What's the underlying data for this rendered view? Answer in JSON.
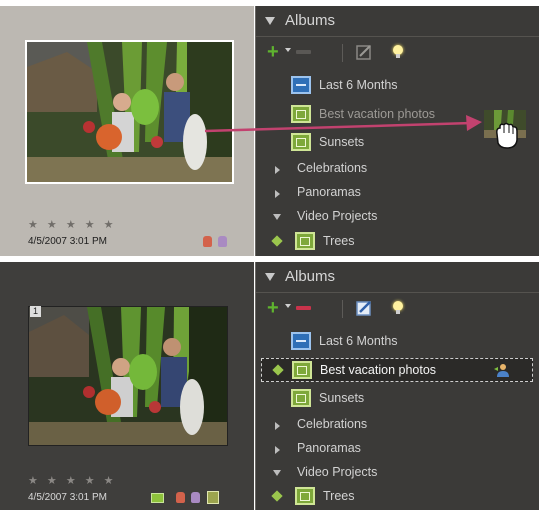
{
  "top": {
    "left": {
      "rating_stars": "★ ★ ★ ★ ★",
      "date": "4/5/2007 3:01 PM"
    },
    "albums": {
      "title": "Albums",
      "items": [
        {
          "label": "Last 6 Months",
          "icon": "album-icon-blue"
        },
        {
          "label": "Best vacation photos",
          "icon": "album-icon-green"
        },
        {
          "label": "Sunsets",
          "icon": "album-icon-green"
        },
        {
          "label": "Celebrations",
          "icon": "collapsed-group"
        },
        {
          "label": "Panoramas",
          "icon": "collapsed-group"
        },
        {
          "label": "Video Projects",
          "icon": "expanded-group"
        },
        {
          "label": "Trees",
          "icon": "album-icon-green"
        }
      ]
    }
  },
  "bottom": {
    "left": {
      "image_number": "1",
      "rating_stars": "★ ★ ★ ★ ★",
      "date": "4/5/2007 3:01 PM"
    },
    "albums": {
      "title": "Albums",
      "items": [
        {
          "label": "Last 6 Months",
          "icon": "album-icon-blue"
        },
        {
          "label": "Best vacation photos",
          "icon": "album-icon-green",
          "selected": true
        },
        {
          "label": "Sunsets",
          "icon": "album-icon-green"
        },
        {
          "label": "Celebrations",
          "icon": "collapsed-group"
        },
        {
          "label": "Panoramas",
          "icon": "collapsed-group"
        },
        {
          "label": "Video Projects",
          "icon": "expanded-group"
        },
        {
          "label": "Trees",
          "icon": "album-icon-green"
        }
      ]
    }
  },
  "colors": {
    "accent_green": "#5fb32f",
    "minus_red_active": "#c9334b",
    "drag_arrow": "#c2426f",
    "tag_red": "#d3624b",
    "tag_purple": "#a98ac2"
  },
  "icons": [
    "add-plus-icon",
    "remove-minus-icon",
    "edit-icon",
    "bulb-icon",
    "hand-cursor-icon",
    "person-share-icon"
  ]
}
